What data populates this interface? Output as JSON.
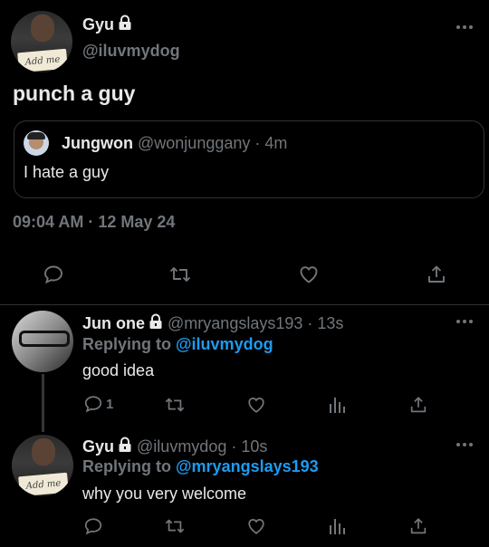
{
  "main_tweet": {
    "display_name": "Gyu",
    "handle": "@iluvmydog",
    "text": "punch a guy",
    "timestamp": "09:04 AM · 12 May 24",
    "avatar_caption": "Add me",
    "quoted": {
      "display_name": "Jungwon",
      "handle": "@wonjunggany",
      "time": "· 4m",
      "text": "I hate a guy"
    }
  },
  "replies": [
    {
      "display_name": "Jun one",
      "handle": "@mryangslays193",
      "time": "· 13s",
      "replying_prefix": "Replying to ",
      "replying_to": "@iluvmydog",
      "text": "good idea",
      "reply_count": "1"
    },
    {
      "display_name": "Gyu",
      "handle": "@iluvmydog",
      "time": "· 10s",
      "replying_prefix": "Replying to ",
      "replying_to": "@mryangslays193",
      "text": "why you very welcome",
      "avatar_caption": "Add me"
    }
  ],
  "icons": [
    "more-icon",
    "lock-icon",
    "reply-icon",
    "retweet-icon",
    "like-icon",
    "share-icon",
    "analytics-icon"
  ],
  "colors": {
    "background": "#000000",
    "text": "#e7e9ea",
    "muted": "#71767b",
    "accent": "#1d9bf0",
    "border": "#2f3336"
  }
}
